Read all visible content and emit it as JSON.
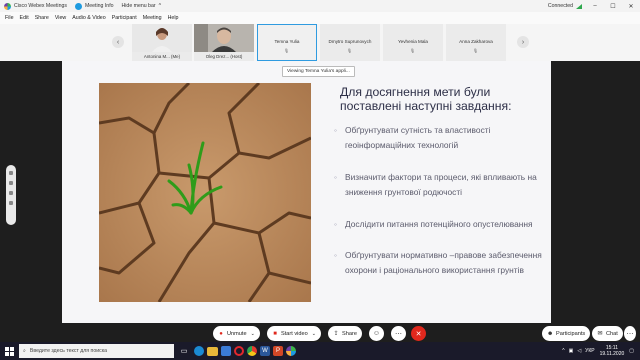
{
  "titlebar": {
    "app": "Cisco Webex Meetings",
    "meeting_info": "Meeting Info",
    "hide_menu": "Hide menu bar",
    "chevron": "^",
    "connection": "Connected",
    "connection_color": "#2fa84f"
  },
  "menu": [
    "File",
    "Edit",
    "Share",
    "View",
    "Audio & Video",
    "Participant",
    "Meeting",
    "Help"
  ],
  "participants": [
    {
      "name": "Antonina M...",
      "tag": "(Me)",
      "has_photo": true
    },
    {
      "name": "Oleg Drez...",
      "tag": "(Host)",
      "has_photo": true
    },
    {
      "name": "Temna Yulia",
      "active": true
    },
    {
      "name": "Dmytro Suprunovych"
    },
    {
      "name": "Yevhenia Mala"
    },
    {
      "name": "Anna Zakharova"
    }
  ],
  "tooltip": "Viewing Temna Yulia's appli...",
  "slide": {
    "title": "Для досягнення мети були поставлені наступні завдання:",
    "bullets": [
      "Обґрунтувати сутність та властивості геоінформаційних технологій",
      "Визначити фактори та процеси, які впливають на зниження грунтової родючості",
      "Дослідити питання потенційного опустелювання",
      "Обґрунтувати нормативно –правове забезпечення охорони і раціонального використання грунтів"
    ],
    "bullet_char": "◦"
  },
  "controls": {
    "unmute": "Unmute",
    "start_video": "Start video",
    "share": "Share",
    "participants": "Participants",
    "chat": "Chat",
    "end_color": "#e0281d"
  },
  "taskbar": {
    "search_placeholder": "Введите здесь текст для поиска",
    "lang": "УКР",
    "time": "15:11",
    "date": "19.11.2020"
  }
}
